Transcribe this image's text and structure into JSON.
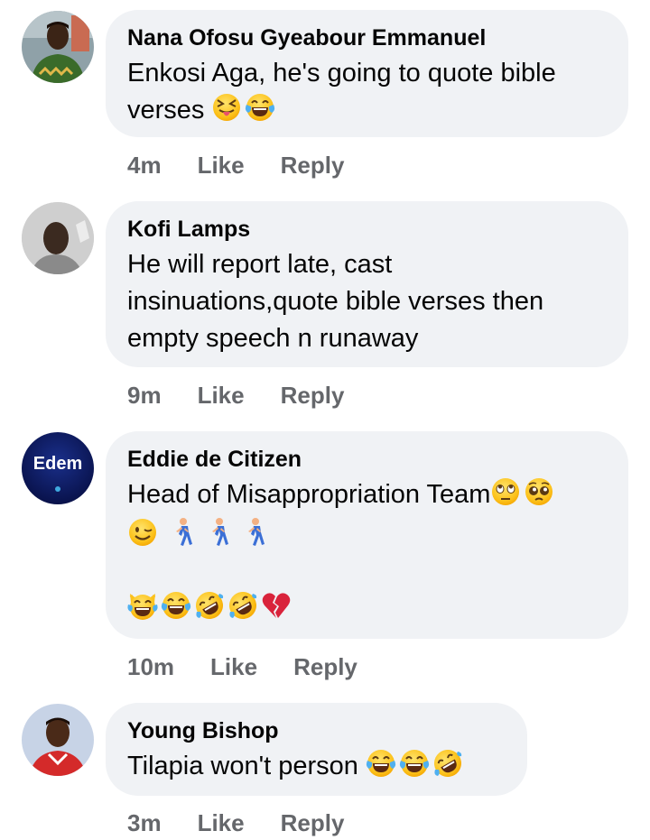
{
  "comments": [
    {
      "author": "Nana Ofosu Gyeabour Emmanuel",
      "text_line1": "Enkosi Aga, he's going to quote bible",
      "text_line2": "verses",
      "emojis": [
        "squinting-tongue-emoji",
        "tears-of-joy-emoji"
      ],
      "time": "4m",
      "like": "Like",
      "reply": "Reply"
    },
    {
      "author": "Kofi Lamps",
      "text_line1": "He will report late, cast",
      "text_line2": "insinuations,quote bible verses then",
      "text_line3": "empty speech n runaway",
      "time": "9m",
      "like": "Like",
      "reply": "Reply"
    },
    {
      "author": "Eddie de Citizen",
      "avatar_text": "Edem",
      "text_line1": "Head of Misappropriation Team",
      "emojis_line1": [
        "rolling-eyes-emoji",
        "pleading-emoji"
      ],
      "emojis_line2": [
        "winking-emoji",
        "person-walking-emoji",
        "person-walking-emoji",
        "person-walking-emoji"
      ],
      "emojis_line3": [
        "cat-tears-of-joy-emoji",
        "tears-of-joy-emoji",
        "rolling-laughing-emoji",
        "rolling-laughing-emoji",
        "broken-heart-emoji"
      ],
      "time": "10m",
      "like": "Like",
      "reply": "Reply"
    },
    {
      "author": "Young Bishop",
      "text_line1": "Tilapia won't person",
      "emojis": [
        "tears-of-joy-emoji",
        "tears-of-joy-emoji",
        "rolling-laughing-emoji"
      ],
      "time": "3m",
      "like": "Like",
      "reply": "Reply"
    }
  ],
  "colors": {
    "bubble": "#f0f2f5",
    "meta_text": "#65676b",
    "text": "#050505",
    "emoji_yellow": "#fcc21b"
  }
}
